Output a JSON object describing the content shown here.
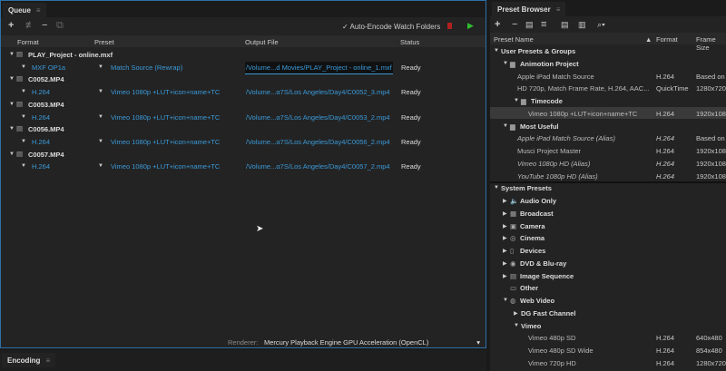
{
  "queue": {
    "tab": "Queue",
    "auto_encode": "Auto-Encode Watch Folders",
    "columns": [
      "Format",
      "Preset",
      "Output File",
      "Status"
    ],
    "groups": [
      {
        "source": "PLAY_Project - online.mxf",
        "format": "MXF OP1a",
        "preset": "Match Source (Rewrap)",
        "output": "/Volume...d Movies/PLAY_Project - online_1.mxf",
        "status": "Ready"
      },
      {
        "source": "C0052.MP4",
        "format": "H.264",
        "preset": "Vimeo 1080p +LUT+icon+name+TC",
        "output": "/Volume...α7S/Los Angeles/Day4/C0052_3.mp4",
        "status": "Ready"
      },
      {
        "source": "C0053.MP4",
        "format": "H.264",
        "preset": "Vimeo 1080p +LUT+icon+name+TC",
        "output": "/Volume...α7S/Los Angeles/Day4/C0053_2.mp4",
        "status": "Ready"
      },
      {
        "source": "C0056.MP4",
        "format": "H.264",
        "preset": "Vimeo 1080p +LUT+icon+name+TC",
        "output": "/Volume...α7S/Los Angeles/Day4/C0056_2.mp4",
        "status": "Ready"
      },
      {
        "source": "C0057.MP4",
        "format": "H.264",
        "preset": "Vimeo 1080p +LUT+icon+name+TC",
        "output": "/Volume...α7S/Los Angeles/Day4/C0057_2.mp4",
        "status": "Ready"
      }
    ],
    "renderer_label": "Renderer:",
    "renderer_value": "Mercury Playback Engine GPU Acceleration (OpenCL)"
  },
  "encoding": {
    "tab": "Encoding"
  },
  "presets": {
    "tab": "Preset Browser",
    "columns": [
      "Preset Name",
      "Format",
      "Frame Size"
    ],
    "rows": [
      {
        "level": 0,
        "name": "User Presets & Groups",
        "kind": "section",
        "open": true
      },
      {
        "level": 1,
        "name": "Animotion Project",
        "kind": "folder",
        "open": true
      },
      {
        "level": 3,
        "name": "Apple iPad Match Source",
        "format": "H.264",
        "size": "Based on"
      },
      {
        "level": 3,
        "name": "HD 720p, Match Frame Rate, H.264, AAC...",
        "format": "QuickTime",
        "size": "1280x720"
      },
      {
        "level": 2,
        "name": "Timecode",
        "kind": "folder",
        "open": true
      },
      {
        "level": 4,
        "name": "Vimeo 1080p +LUT+icon+name+TC",
        "format": "H.264",
        "size": "1920x108",
        "selected": true
      },
      {
        "level": 1,
        "name": "Most Useful",
        "kind": "folder",
        "open": true
      },
      {
        "level": 3,
        "name": "Apple iPad Match Source (Alias)",
        "format": "H.264",
        "size": "Based on",
        "alias": true
      },
      {
        "level": 3,
        "name": "Musci Project Master",
        "format": "H.264",
        "size": "1920x108"
      },
      {
        "level": 3,
        "name": "Vimeo 1080p HD (Alias)",
        "format": "H.264",
        "size": "1920x108",
        "alias": true
      },
      {
        "level": 3,
        "name": "YouTube 1080p HD (Alias)",
        "format": "H.264",
        "size": "1920x108",
        "alias": true
      },
      {
        "level": 0,
        "name": "System Presets",
        "kind": "section",
        "open": true
      },
      {
        "level": 1,
        "name": "Audio Only",
        "kind": "cat",
        "icon": "🔈"
      },
      {
        "level": 1,
        "name": "Broadcast",
        "kind": "cat",
        "icon": "▦"
      },
      {
        "level": 1,
        "name": "Camera",
        "kind": "cat",
        "icon": "▣"
      },
      {
        "level": 1,
        "name": "Cinema",
        "kind": "cat",
        "icon": "◎"
      },
      {
        "level": 1,
        "name": "Devices",
        "kind": "cat",
        "icon": "▯"
      },
      {
        "level": 1,
        "name": "DVD & Blu-ray",
        "kind": "cat",
        "icon": "◉"
      },
      {
        "level": 1,
        "name": "Image Sequence",
        "kind": "cat",
        "icon": "▤"
      },
      {
        "level": 1,
        "name": "Other",
        "kind": "cat",
        "icon": "▭",
        "leaf": true
      },
      {
        "level": 1,
        "name": "Web Video",
        "kind": "cat",
        "icon": "◍",
        "open": true
      },
      {
        "level": 2,
        "name": "DG Fast Channel",
        "kind": "sub"
      },
      {
        "level": 2,
        "name": "Vimeo",
        "kind": "sub",
        "open": true
      },
      {
        "level": 4,
        "name": "Vimeo 480p SD",
        "format": "H.264",
        "size": "640x480"
      },
      {
        "level": 4,
        "name": "Vimeo 480p SD Wide",
        "format": "H.264",
        "size": "854x480"
      },
      {
        "level": 4,
        "name": "Vimeo 720p HD",
        "format": "H.264",
        "size": "1280x720"
      }
    ]
  }
}
